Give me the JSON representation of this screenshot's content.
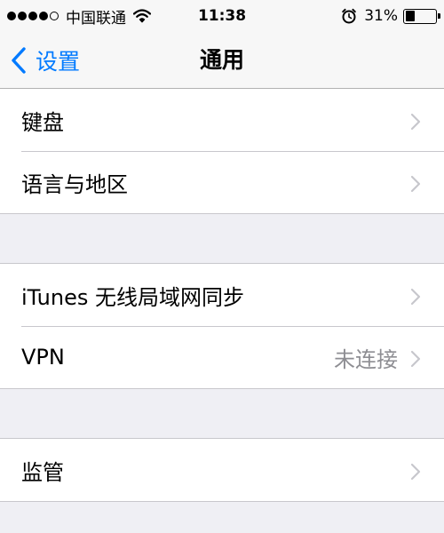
{
  "status_bar": {
    "carrier": "中国联通",
    "time": "11:38",
    "battery_percent": "31%",
    "battery_level": 0.31,
    "signal_bars_filled": 4,
    "signal_bars_total": 5
  },
  "nav": {
    "back_label": "设置",
    "title": "通用"
  },
  "groups": [
    {
      "rows": [
        {
          "label": "键盘",
          "value": ""
        },
        {
          "label": "语言与地区",
          "value": ""
        }
      ]
    },
    {
      "rows": [
        {
          "label": "iTunes 无线局域网同步",
          "value": ""
        },
        {
          "label": "VPN",
          "value": "未连接"
        }
      ]
    },
    {
      "rows": [
        {
          "label": "监管",
          "value": ""
        }
      ]
    }
  ],
  "colors": {
    "accent": "#007aff",
    "background": "#efeff4",
    "secondary_text": "#8e8e93"
  },
  "icons": [
    "wifi-icon",
    "alarm-icon",
    "battery-icon",
    "chevron-left-icon",
    "chevron-right-icon"
  ]
}
